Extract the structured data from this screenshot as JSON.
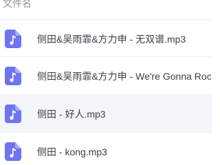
{
  "header": {
    "column_label": "文件名"
  },
  "files": [
    {
      "name": "侧田&吴雨霏&方力申 - 无双谱.mp3",
      "icon": "music-file-icon"
    },
    {
      "name": "侧田&吴雨霏&方力申 - We're Gonna Rock",
      "icon": "music-file-icon"
    },
    {
      "name": "侧田 - 好人.mp3",
      "icon": "music-file-icon",
      "selected": true
    },
    {
      "name": "侧田 - kong.mp3",
      "icon": "music-file-icon"
    }
  ],
  "colors": {
    "icon_bg": "#6f74f2",
    "text": "#3a3f47",
    "header_text": "#8e939b",
    "row_selected_bg": "#f3f6fb",
    "divider": "#eef0f3"
  }
}
